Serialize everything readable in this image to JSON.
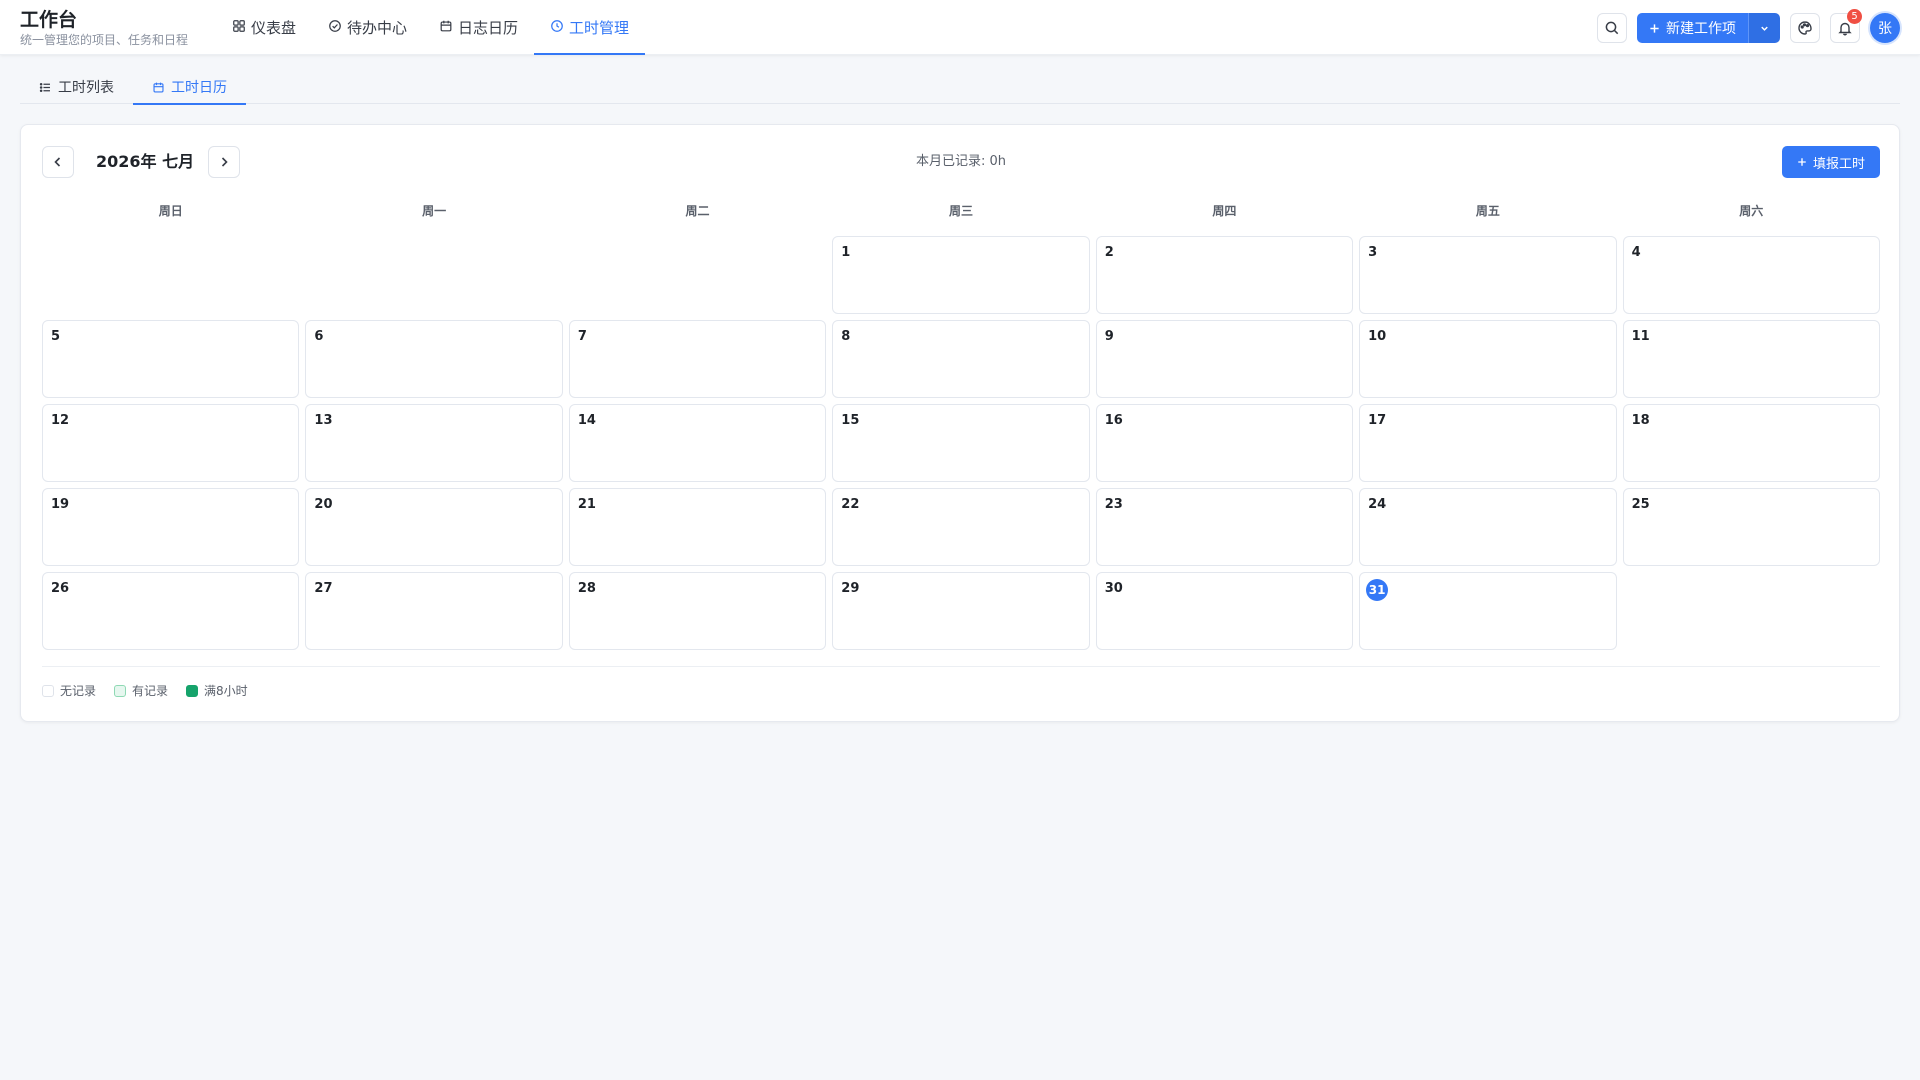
{
  "app": {
    "title": "工作台",
    "subtitle": "统一管理您的项目、任务和日程"
  },
  "nav": [
    {
      "label": "仪表盘",
      "icon": "grid-icon",
      "active": false
    },
    {
      "label": "待办中心",
      "icon": "check-circle-icon",
      "active": false
    },
    {
      "label": "日志日历",
      "icon": "calendar-icon",
      "active": false
    },
    {
      "label": "工时管理",
      "icon": "clock-icon",
      "active": true
    }
  ],
  "header_actions": {
    "search_icon": "search-icon",
    "new_item_label": "新建工作项",
    "theme_icon": "palette-icon",
    "notification_icon": "bell-icon",
    "notification_count": "5",
    "avatar_text": "张"
  },
  "subtabs": [
    {
      "label": "工时列表",
      "icon": "list-icon",
      "active": false
    },
    {
      "label": "工时日历",
      "icon": "calendar-icon",
      "active": true
    }
  ],
  "calendar": {
    "month_title": "2026年 七月",
    "stat": "本月已记录: 0h",
    "fill_label": "填报工时",
    "weekdays": [
      "周日",
      "周一",
      "周二",
      "周三",
      "周四",
      "周五",
      "周六"
    ],
    "leading_blanks": 3,
    "days_in_month": 31,
    "today": 31,
    "legend": [
      {
        "label": "无记录",
        "color": "#ffffff",
        "border": "#dfe3ea"
      },
      {
        "label": "有记录",
        "color": "#e6f7ef",
        "border": "#8fd9b4"
      },
      {
        "label": "满8小时",
        "color": "#16a36b",
        "border": "#16a36b"
      }
    ]
  },
  "colors": {
    "accent": "#3478f6",
    "background": "#f5f7fa",
    "badge": "#f04f43"
  }
}
